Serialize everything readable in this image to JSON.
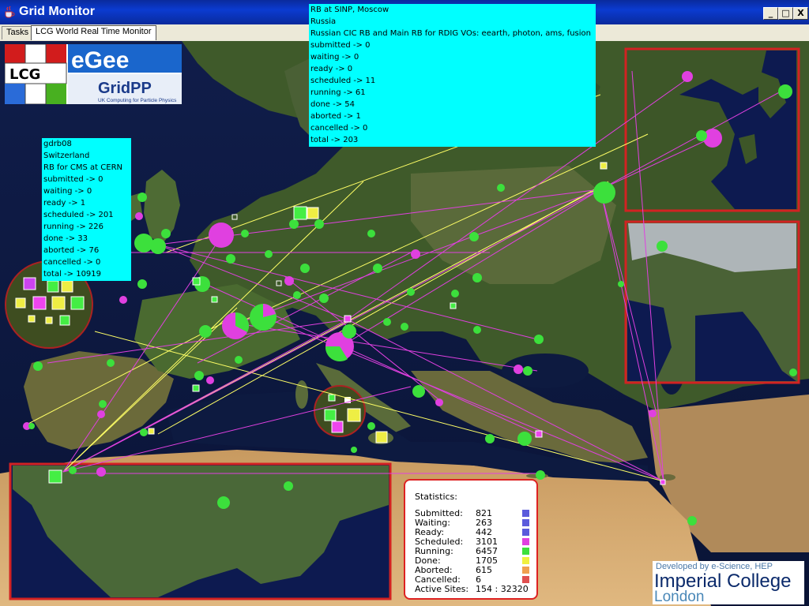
{
  "window": {
    "title": "Grid Monitor",
    "controls": {
      "minimize": "_",
      "maximize": "□",
      "close": "X"
    }
  },
  "tabs": [
    {
      "label": "Tasks",
      "active": false
    },
    {
      "label": "LCG World Real Time Monitor",
      "active": true
    }
  ],
  "logos": {
    "lcg": "LCG",
    "egee": "eGee",
    "gridpp": "GridPP",
    "gridpp_tagline": "UK Computing for Particle Physics"
  },
  "popup_moscow": {
    "lines": [
      "RB at SINP, Moscow",
      "Russia",
      "Russian CIC RB and Main RB for RDIG VOs: eearth, photon, ams, fusion",
      "submitted -> 0",
      "waiting -> 0",
      "ready -> 0",
      "scheduled -> 11",
      "running -> 61",
      "done -> 54",
      "aborted -> 1",
      "cancelled -> 0",
      "total -> 203"
    ]
  },
  "popup_cern": {
    "lines": [
      "gdrb08",
      "Switzerland",
      "RB for CMS at CERN",
      "submitted -> 0",
      "waiting -> 0",
      "ready -> 1",
      "scheduled -> 201",
      "running -> 226",
      "done -> 33",
      "aborted -> 76",
      "cancelled -> 0",
      "total -> 10919"
    ]
  },
  "statistics": {
    "title": "Statistics:",
    "rows": [
      {
        "label": "Submitted:",
        "value": "821",
        "color": "#5b5bdc"
      },
      {
        "label": "Waiting:",
        "value": "263",
        "color": "#5b5bdc"
      },
      {
        "label": "Ready:",
        "value": "442",
        "color": "#5b5bdc"
      },
      {
        "label": "Scheduled:",
        "value": "3101",
        "color": "#e040e0"
      },
      {
        "label": "Running:",
        "value": "6457",
        "color": "#3ce03c"
      },
      {
        "label": "Done:",
        "value": "1705",
        "color": "#f0f040"
      },
      {
        "label": "Aborted:",
        "value": "615",
        "color": "#f0a050"
      },
      {
        "label": "Cancelled:",
        "value": "6",
        "color": "#e05050"
      },
      {
        "label": "Active Sites:",
        "value": "154 : 32320",
        "color": ""
      }
    ]
  },
  "credit": {
    "line1": "Developed by e-Science, HEP",
    "line2": "Imperial College",
    "line3": "London"
  },
  "colors": {
    "titlebar": "#0b3bd0",
    "popup": "#00ffff",
    "site_running": "#3ce03c",
    "site_scheduled": "#e040e0",
    "job_path": "#e040e0",
    "rb_path": "#ffff66",
    "inset_border": "#d22222"
  }
}
